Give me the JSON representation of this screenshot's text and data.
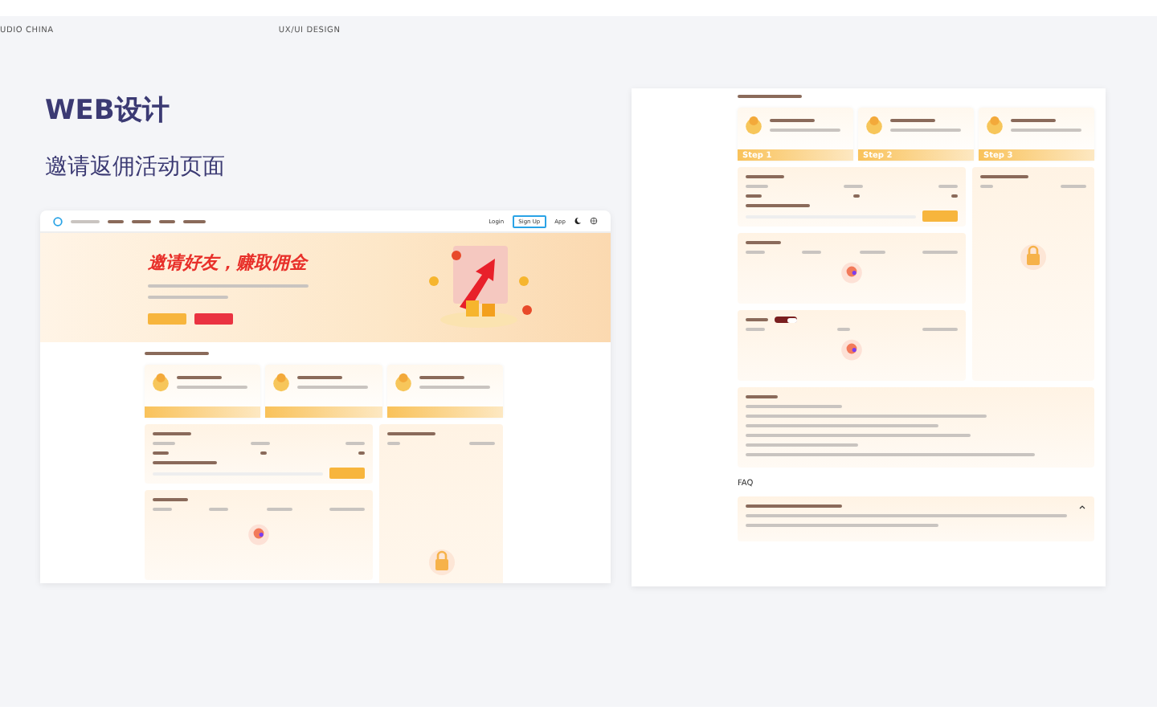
{
  "header": {
    "studio_label": "UDIO CHINA",
    "design_label": "UX/UI DESIGN"
  },
  "title": "WEB设计",
  "subtitle": "邀请返佣活动页面",
  "desktop_mockup": {
    "nav": {
      "login": "Login",
      "signup": "Sign Up",
      "app": "App"
    },
    "banner_title": "邀请好友，赚取佣金"
  },
  "detail_mockup": {
    "steps": [
      "Step 1",
      "Step 2",
      "Step 3"
    ],
    "rebate_toggle": {
      "on": true
    },
    "faq_heading": "FAQ"
  }
}
